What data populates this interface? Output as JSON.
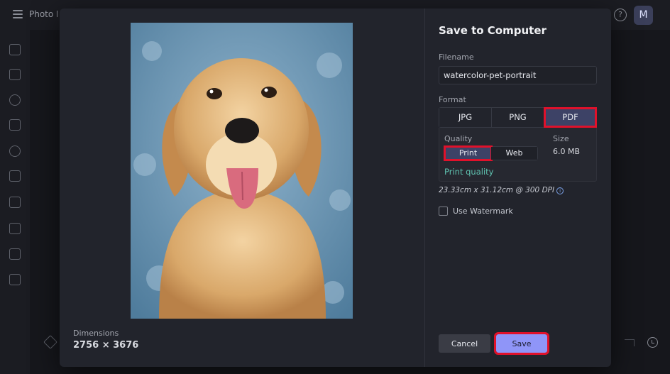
{
  "app": {
    "title": "Photo Editor",
    "avatar_initial": "M",
    "help_glyph": "?"
  },
  "left_rail_icons": [
    "image-icon",
    "adjust-icon",
    "eye-icon",
    "sparkle-icon",
    "palette-icon",
    "film-icon",
    "elements-icon",
    "frame-icon",
    "text-icon",
    "sticker-icon"
  ],
  "dialog": {
    "title": "Save to Computer",
    "dimensions_label": "Dimensions",
    "dimensions_value": "2756 × 3676",
    "filename_label": "Filename",
    "filename_value": "watercolor-pet-portrait",
    "format_label": "Format",
    "formats": [
      "JPG",
      "PNG",
      "PDF"
    ],
    "selected_format": "PDF",
    "quality_label": "Quality",
    "quality_options": [
      "Print",
      "Web"
    ],
    "selected_quality": "Print",
    "size_label": "Size",
    "size_value": "6.0 MB",
    "quality_hint": "Print quality",
    "dpi_text": "23.33cm x 31.12cm @ 300 DPI",
    "info_glyph": "i",
    "watermark_label": "Use Watermark",
    "watermark_checked": false,
    "cancel_label": "Cancel",
    "save_label": "Save"
  },
  "colors": {
    "accent": "#8f95f8",
    "highlight": "#e0112b",
    "quality_hint": "#5fc2b0",
    "selected_segment": "#3d4266"
  }
}
